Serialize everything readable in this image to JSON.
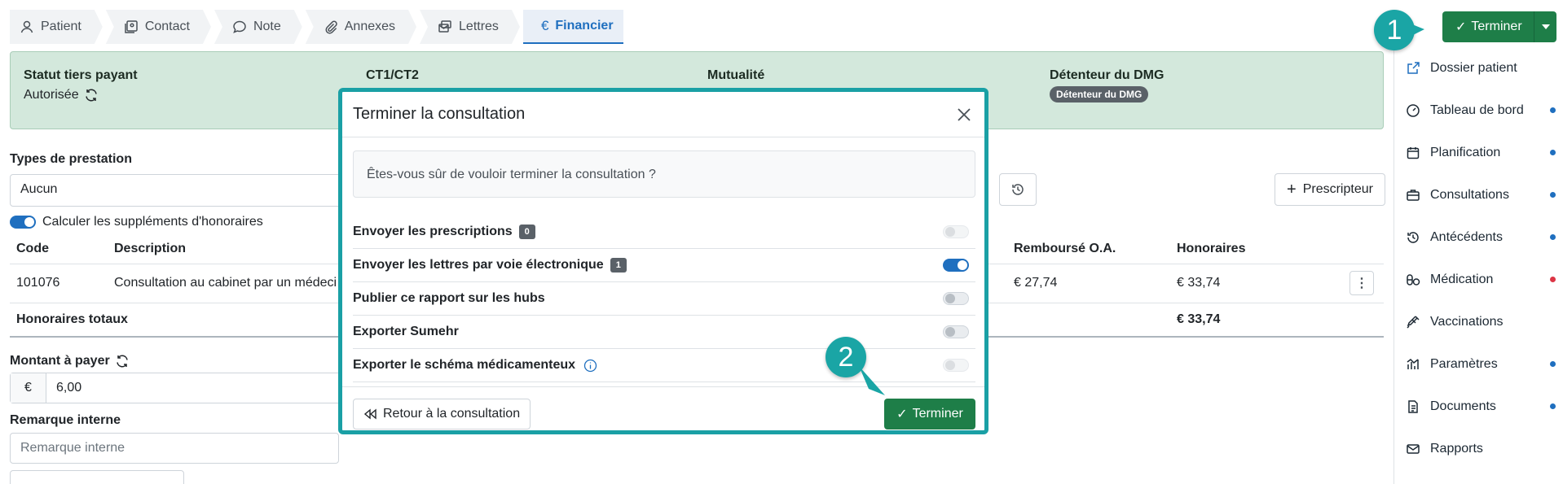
{
  "tabs": [
    {
      "label": "Patient",
      "icon": "user-icon"
    },
    {
      "label": "Contact",
      "icon": "contact-card-icon"
    },
    {
      "label": "Note",
      "icon": "chat-bubble-icon"
    },
    {
      "label": "Annexes",
      "icon": "paperclip-icon"
    },
    {
      "label": "Lettres",
      "icon": "letters-icon"
    },
    {
      "label": "Financier",
      "icon": "euro-icon",
      "active": true
    }
  ],
  "status": {
    "tiers_payant_title": "Statut tiers payant",
    "tiers_payant_value": "Autorisée",
    "ct_title": "CT1/CT2",
    "mutualite_title": "Mutualité",
    "dmg_title": "Détenteur du DMG",
    "dmg_badge": "Détenteur du DMG"
  },
  "form": {
    "types_label": "Types de prestation",
    "types_value": "Aucun",
    "calc_label": "Calculer les suppléments d'honoraires",
    "prescripteur_button": "Prescripteur",
    "montant_label": "Montant à payer",
    "currency_symbol": "€",
    "montant_value": "6,00",
    "remarque_label": "Remarque interne",
    "remarque_placeholder": "Remarque interne"
  },
  "table": {
    "headers": {
      "code": "Code",
      "description": "Description",
      "rembourse": "Remboursé O.A.",
      "honoraires": "Honoraires"
    },
    "rows": [
      {
        "code": "101076",
        "description": "Consultation au cabinet par un médeci",
        "rembourse": "€ 27,74",
        "honoraires": "€ 33,74"
      }
    ],
    "total_label": "Honoraires totaux",
    "total_value": "€ 33,74"
  },
  "top_action": {
    "label": "Terminer"
  },
  "sidebar": {
    "items": [
      {
        "label": "Dossier patient",
        "icon": "external-link-icon",
        "dot": null
      },
      {
        "label": "Tableau de bord",
        "icon": "dashboard-icon",
        "dot": "blue"
      },
      {
        "label": "Planification",
        "icon": "calendar-icon",
        "dot": "blue"
      },
      {
        "label": "Consultations",
        "icon": "briefcase-icon",
        "dot": "blue"
      },
      {
        "label": "Antécédents",
        "icon": "history-icon",
        "dot": "blue"
      },
      {
        "label": "Médication",
        "icon": "pills-icon",
        "dot": "red"
      },
      {
        "label": "Vaccinations",
        "icon": "syringe-icon",
        "dot": null
      },
      {
        "label": "Paramètres",
        "icon": "chart-icon",
        "dot": "blue"
      },
      {
        "label": "Documents",
        "icon": "document-icon",
        "dot": "blue"
      },
      {
        "label": "Rapports",
        "icon": "mail-icon",
        "dot": null
      }
    ]
  },
  "steps": {
    "one": "1",
    "two": "2"
  },
  "modal": {
    "title": "Terminer la consultation",
    "question": "Êtes-vous sûr de vouloir terminer la consultation ?",
    "options": [
      {
        "label": "Envoyer les prescriptions",
        "badge": "0",
        "on": false,
        "disabled": true
      },
      {
        "label": "Envoyer les lettres par voie électronique",
        "badge": "1",
        "on": true,
        "disabled": false
      },
      {
        "label": "Publier ce rapport sur les hubs",
        "badge": null,
        "on": false,
        "disabled": false
      },
      {
        "label": "Exporter Sumehr",
        "badge": null,
        "on": false,
        "disabled": false
      },
      {
        "label": "Exporter le schéma médicamenteux",
        "badge": null,
        "on": false,
        "disabled": true,
        "info": true
      }
    ],
    "back_button": "Retour à la consultation",
    "confirm_button": "Terminer"
  },
  "colors": {
    "accent": "#1f6fbf",
    "success": "#1e7e48",
    "highlight": "#1aa5a5",
    "status_bg": "#d3e8dc"
  }
}
